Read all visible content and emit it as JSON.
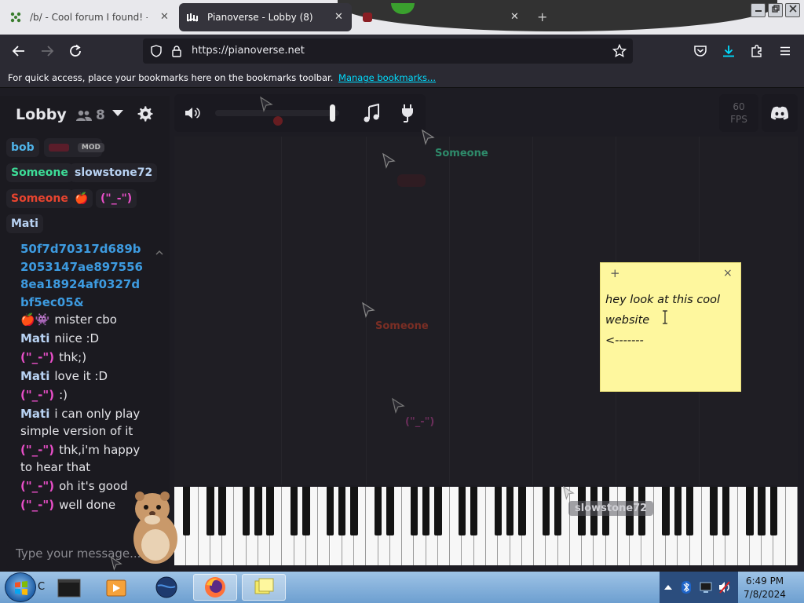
{
  "browser": {
    "tabs": [
      {
        "title": "/b/ - Cool forum I found! - Random",
        "close": "✕"
      },
      {
        "title": "Pianoverse - Lobby (8)",
        "close": "✕"
      },
      {
        "title": "",
        "close": "✕"
      }
    ],
    "new_tab": "+",
    "url": "https://pianoverse.net",
    "bookmarks_text": "For quick access, place your bookmarks here on the bookmarks toolbar.",
    "manage_bookmarks": "Manage bookmarks..."
  },
  "room": {
    "name": "Lobby",
    "user_count": "8"
  },
  "users": [
    {
      "name": "bob",
      "color": "#4fb3e8"
    },
    {
      "name": "",
      "color": "#7a2a3a",
      "badge": "MOD"
    },
    {
      "name": "Someone",
      "color": "#3ddc97"
    },
    {
      "name": "slowstone72",
      "color": "#b8d2f2"
    },
    {
      "name": "Someone",
      "color": "#e8442f"
    },
    {
      "name": "🍎",
      "color": "#ffffff"
    },
    {
      "name": "(\"_-\")",
      "color": "#e84fc8"
    },
    {
      "name": "Mati",
      "color": "#b8d2f2"
    }
  ],
  "chat": {
    "link_text": "50f7d70317d689b2053147ae8975568ea18924af0327dbf5ec05&",
    "messages": [
      {
        "nick": "🍎👾",
        "nick_color": "#e8442f",
        "text": "mister cbo"
      },
      {
        "nick": "Mati",
        "nick_color": "#b8d2f2",
        "text": "niice :D"
      },
      {
        "nick": "(\"_-\")",
        "nick_color": "#e84fc8",
        "text": "thk;)"
      },
      {
        "nick": "Mati",
        "nick_color": "#b8d2f2",
        "text": "love it :D"
      },
      {
        "nick": "(\"_-\")",
        "nick_color": "#e84fc8",
        "text": ":)"
      },
      {
        "nick": "Mati",
        "nick_color": "#b8d2f2",
        "text": "i can only play simple version of it"
      },
      {
        "nick": "(\"_-\")",
        "nick_color": "#e84fc8",
        "text": "thk,i'm happy to hear that"
      },
      {
        "nick": "(\"_-\")",
        "nick_color": "#e84fc8",
        "text": "oh it's good"
      },
      {
        "nick": "(\"_-\")",
        "nick_color": "#e84fc8",
        "text": "well done"
      }
    ],
    "input_placeholder": "Type your message..."
  },
  "toolbar": {
    "volume": 0.97,
    "fps_value": "60",
    "fps_label": "FPS"
  },
  "cursors": [
    {
      "label": "Someone",
      "color": "#2e8a6a"
    },
    {
      "label": "Someone",
      "color": "#7a2e24"
    },
    {
      "label": "(\"_-\")",
      "color": "#6a2e5a"
    },
    {
      "label": "slowstone72",
      "color": "#4a4a52"
    }
  ],
  "sticky_note": {
    "add": "+",
    "close": "×",
    "text": "hey look at this cool website\n<-------"
  },
  "taskbar": {
    "start_suffix": "C",
    "time": "6:49 PM",
    "date": "7/8/2024"
  },
  "colors": {
    "accent": "#00ddff",
    "app_bg": "#1d1c23"
  }
}
